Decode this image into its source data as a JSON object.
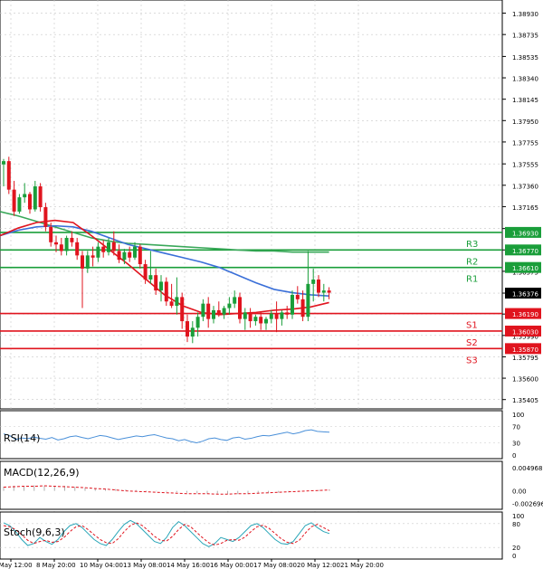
{
  "colors": {
    "bull": "#1a9e3a",
    "bear": "#e0141e",
    "ma_fast": "#e0141e",
    "ma_mid": "#3a6fd8",
    "ma_slow": "#3aa85a",
    "resistance": "#1a9e3a",
    "support": "#e0141e",
    "current_box": "#000000",
    "grid": "#c8c8c8"
  },
  "chart_data": [
    {
      "type": "candlestick",
      "ylim": [
        1.3532,
        1.3905
      ],
      "y_ticks": [
        "1.38930",
        "1.38735",
        "1.38535",
        "1.38340",
        "1.38145",
        "1.37950",
        "1.37755",
        "1.37555",
        "1.37360",
        "1.37165",
        "1.36965",
        "1.36770",
        "1.36575",
        "1.36376",
        "1.36185",
        "1.35990",
        "1.35795",
        "1.35600",
        "1.35405"
      ],
      "y_tick_values": [
        1.3893,
        1.38735,
        1.38535,
        1.3834,
        1.38145,
        1.3795,
        1.37755,
        1.37555,
        1.3736,
        1.37165,
        1.36965,
        1.3677,
        1.36575,
        1.36376,
        1.36185,
        1.3599,
        1.35795,
        1.356,
        1.35405
      ],
      "x_ticks": [
        "7 May 12:00",
        "8 May 20:00",
        "10 May 04:00",
        "13 May 08:00",
        "14 May 16:00",
        "16 May 00:00",
        "17 May 08:00",
        "20 May 12:00",
        "21 May 20:00"
      ],
      "current_price": {
        "label": "1.36376",
        "value": 1.36376
      },
      "pivot_levels": [
        {
          "name": "R3",
          "label": "1.36930",
          "value": 1.3693,
          "kind": "resistance"
        },
        {
          "name": "R2",
          "label": "1.36770",
          "value": 1.3677,
          "kind": "resistance"
        },
        {
          "name": "R1",
          "label": "1.36610",
          "value": 1.3661,
          "kind": "resistance"
        },
        {
          "name": "S1",
          "label": "1.36190",
          "value": 1.3619,
          "kind": "support"
        },
        {
          "name": "S2",
          "label": "1.36030",
          "value": 1.3603,
          "kind": "support"
        },
        {
          "name": "S3",
          "label": "1.35870",
          "value": 1.3587,
          "kind": "support"
        }
      ],
      "candles": [
        [
          1.3755,
          1.376,
          1.3735,
          1.3758
        ],
        [
          1.3758,
          1.3762,
          1.3728,
          1.3732
        ],
        [
          1.3732,
          1.374,
          1.3708,
          1.3712
        ],
        [
          1.3712,
          1.3728,
          1.371,
          1.3725
        ],
        [
          1.3725,
          1.3738,
          1.372,
          1.3728
        ],
        [
          1.3728,
          1.373,
          1.371,
          1.3714
        ],
        [
          1.3714,
          1.374,
          1.3712,
          1.3735
        ],
        [
          1.3735,
          1.3738,
          1.3712,
          1.3716
        ],
        [
          1.3716,
          1.372,
          1.3694,
          1.3698
        ],
        [
          1.3698,
          1.3702,
          1.368,
          1.3684
        ],
        [
          1.3684,
          1.369,
          1.3675,
          1.3682
        ],
        [
          1.3682,
          1.3688,
          1.3672,
          1.3676
        ],
        [
          1.3676,
          1.369,
          1.3672,
          1.3688
        ],
        [
          1.3688,
          1.3694,
          1.368,
          1.3684
        ],
        [
          1.3684,
          1.3688,
          1.3668,
          1.3672
        ],
        [
          1.3672,
          1.3676,
          1.3624,
          1.366
        ],
        [
          1.366,
          1.3676,
          1.3656,
          1.3672
        ],
        [
          1.3672,
          1.368,
          1.3662,
          1.367
        ],
        [
          1.367,
          1.3684,
          1.3666,
          1.368
        ],
        [
          1.368,
          1.3686,
          1.367,
          1.3675
        ],
        [
          1.3675,
          1.3688,
          1.3672,
          1.3684
        ],
        [
          1.3684,
          1.3694,
          1.3672,
          1.3676
        ],
        [
          1.3676,
          1.3682,
          1.3665,
          1.3668
        ],
        [
          1.3668,
          1.3678,
          1.3664,
          1.3675
        ],
        [
          1.3675,
          1.368,
          1.3666,
          1.367
        ],
        [
          1.367,
          1.3684,
          1.3668,
          1.368
        ],
        [
          1.368,
          1.3682,
          1.366,
          1.3664
        ],
        [
          1.3664,
          1.3668,
          1.3646,
          1.365
        ],
        [
          1.365,
          1.3676,
          1.3646,
          1.3654
        ],
        [
          1.3654,
          1.366,
          1.3636,
          1.364
        ],
        [
          1.364,
          1.3654,
          1.363,
          1.3648
        ],
        [
          1.3648,
          1.3652,
          1.3626,
          1.363
        ],
        [
          1.363,
          1.3646,
          1.3624,
          1.3626
        ],
        [
          1.3626,
          1.3652,
          1.3618,
          1.3634
        ],
        [
          1.3634,
          1.3638,
          1.3605,
          1.3612
        ],
        [
          1.3612,
          1.3618,
          1.3593,
          1.3598
        ],
        [
          1.3598,
          1.3612,
          1.3592,
          1.3606
        ],
        [
          1.3606,
          1.362,
          1.3598,
          1.3616
        ],
        [
          1.3616,
          1.3632,
          1.3612,
          1.3628
        ],
        [
          1.3628,
          1.3634,
          1.3606,
          1.3614
        ],
        [
          1.3614,
          1.3626,
          1.361,
          1.3622
        ],
        [
          1.3622,
          1.363,
          1.3616,
          1.3618
        ],
        [
          1.3618,
          1.3626,
          1.3614,
          1.3624
        ],
        [
          1.3624,
          1.3634,
          1.3618,
          1.3628
        ],
        [
          1.3628,
          1.364,
          1.3624,
          1.3634
        ],
        [
          1.3634,
          1.3638,
          1.361,
          1.3614
        ],
        [
          1.3614,
          1.3624,
          1.3604,
          1.362
        ],
        [
          1.362,
          1.3624,
          1.3606,
          1.3612
        ],
        [
          1.3612,
          1.3618,
          1.3608,
          1.3616
        ],
        [
          1.3616,
          1.362,
          1.3604,
          1.361
        ],
        [
          1.361,
          1.3616,
          1.3604,
          1.3614
        ],
        [
          1.3614,
          1.3622,
          1.361,
          1.3619
        ],
        [
          1.3619,
          1.363,
          1.3602,
          1.3614
        ],
        [
          1.3614,
          1.3622,
          1.3608,
          1.362
        ],
        [
          1.362,
          1.3626,
          1.3614,
          1.3618
        ],
        [
          1.3618,
          1.364,
          1.3614,
          1.3636
        ],
        [
          1.3636,
          1.3644,
          1.3628,
          1.3632
        ],
        [
          1.3632,
          1.364,
          1.3612,
          1.3616
        ],
        [
          1.3616,
          1.3676,
          1.3612,
          1.3646
        ],
        [
          1.3646,
          1.366,
          1.363,
          1.365
        ],
        [
          1.365,
          1.3654,
          1.3634,
          1.3638
        ],
        [
          1.3638,
          1.3646,
          1.363,
          1.364
        ],
        [
          1.364,
          1.3643,
          1.3632,
          1.3638
        ]
      ],
      "ma_fast": [
        1.369,
        1.3697,
        1.3702,
        1.3704,
        1.3702,
        1.369,
        1.3677,
        1.3664,
        1.365,
        1.3636,
        1.3626,
        1.362,
        1.3618,
        1.3619,
        1.362,
        1.3622,
        1.3623,
        1.3625,
        1.3629
      ],
      "ma_mid": [
        1.369,
        1.3695,
        1.3698,
        1.3699,
        1.3698,
        1.3694,
        1.3688,
        1.3682,
        1.3678,
        1.3674,
        1.367,
        1.3666,
        1.3661,
        1.3654,
        1.3647,
        1.3641,
        1.3638,
        1.3636,
        1.3635
      ],
      "ma_slow": [
        1.3712,
        1.3708,
        1.3703,
        1.3698,
        1.3693,
        1.3688,
        1.3685,
        1.3683,
        1.3682,
        1.3681,
        1.368,
        1.3679,
        1.3678,
        1.3677,
        1.3676,
        1.3676,
        1.3675,
        1.3675,
        1.3675
      ]
    },
    {
      "type": "line",
      "title": "RSI(14)",
      "ylim": [
        0,
        100
      ],
      "y_ticks": [
        "100",
        "70",
        "30",
        "0"
      ],
      "y_tick_values": [
        100,
        70,
        30,
        0
      ],
      "values": [
        52,
        48,
        38,
        42,
        40,
        44,
        41,
        39,
        43,
        37,
        40,
        45,
        47,
        43,
        40,
        44,
        48,
        46,
        42,
        38,
        41,
        44,
        47,
        45,
        48,
        50,
        46,
        42,
        40,
        35,
        38,
        33,
        30,
        34,
        40,
        42,
        38,
        36,
        42,
        44,
        39,
        41,
        45,
        48,
        47,
        50,
        53,
        56,
        52,
        55,
        60,
        62,
        58,
        57,
        56
      ]
    },
    {
      "type": "bar",
      "title": "MACD(12,26,9)",
      "ylim": [
        -0.0028,
        0.0052
      ],
      "y_ticks": [
        "0.004968",
        "0.00",
        "-0.002696"
      ],
      "y_tick_values": [
        0.004968,
        0,
        -0.002696
      ],
      "values": [
        0.0009,
        0.0011,
        0.001,
        0.0012,
        0.0011,
        0.001,
        0.0011,
        0.0009,
        0.0007,
        0.0006,
        0.0005,
        0.0004,
        0.0003,
        0.0002,
        0.0001,
        -0.0001,
        -0.0002,
        -0.0003,
        -0.0004,
        -0.0005,
        -0.0006,
        -0.0006,
        -0.0007,
        -0.0007,
        -0.0006,
        -0.0005,
        -0.0005,
        -0.0004,
        -0.0003,
        -0.0002,
        0.0,
        0.0002,
        0.0003
      ],
      "signal": [
        0.0008,
        0.0009,
        0.001,
        0.001,
        0.0011,
        0.001,
        0.0009,
        0.0008,
        0.0007,
        0.0005,
        0.0004,
        0.0002,
        0.0,
        -0.0001,
        -0.0002,
        -0.0003,
        -0.0004,
        -0.0005,
        -0.0006,
        -0.0006,
        -0.0006,
        -0.0007,
        -0.0007,
        -0.0006,
        -0.0006,
        -0.0005,
        -0.0004,
        -0.0003,
        -0.0002,
        -0.0001,
        0.0,
        0.0001,
        0.0002
      ]
    },
    {
      "type": "line",
      "title": "Stoch(9,6,3)",
      "ylim": [
        0,
        100
      ],
      "y_ticks": [
        "100",
        "80",
        "20",
        "0"
      ],
      "y_tick_values": [
        100,
        80,
        20,
        0
      ],
      "k": [
        82,
        75,
        60,
        40,
        25,
        30,
        45,
        35,
        28,
        40,
        60,
        75,
        80,
        70,
        55,
        40,
        30,
        25,
        40,
        60,
        78,
        88,
        80,
        65,
        50,
        35,
        30,
        45,
        70,
        85,
        75,
        60,
        45,
        30,
        22,
        30,
        45,
        40,
        35,
        45,
        60,
        75,
        80,
        70,
        55,
        40,
        30,
        28,
        35,
        55,
        75,
        82,
        70,
        60,
        55
      ],
      "d": [
        75,
        72,
        65,
        52,
        38,
        30,
        35,
        38,
        33,
        35,
        45,
        60,
        72,
        75,
        65,
        52,
        40,
        32,
        30,
        42,
        60,
        75,
        82,
        75,
        62,
        48,
        38,
        36,
        48,
        65,
        78,
        72,
        58,
        44,
        32,
        26,
        30,
        38,
        40,
        38,
        46,
        60,
        72,
        76,
        68,
        55,
        42,
        33,
        30,
        38,
        56,
        72,
        78,
        70,
        62
      ]
    }
  ]
}
